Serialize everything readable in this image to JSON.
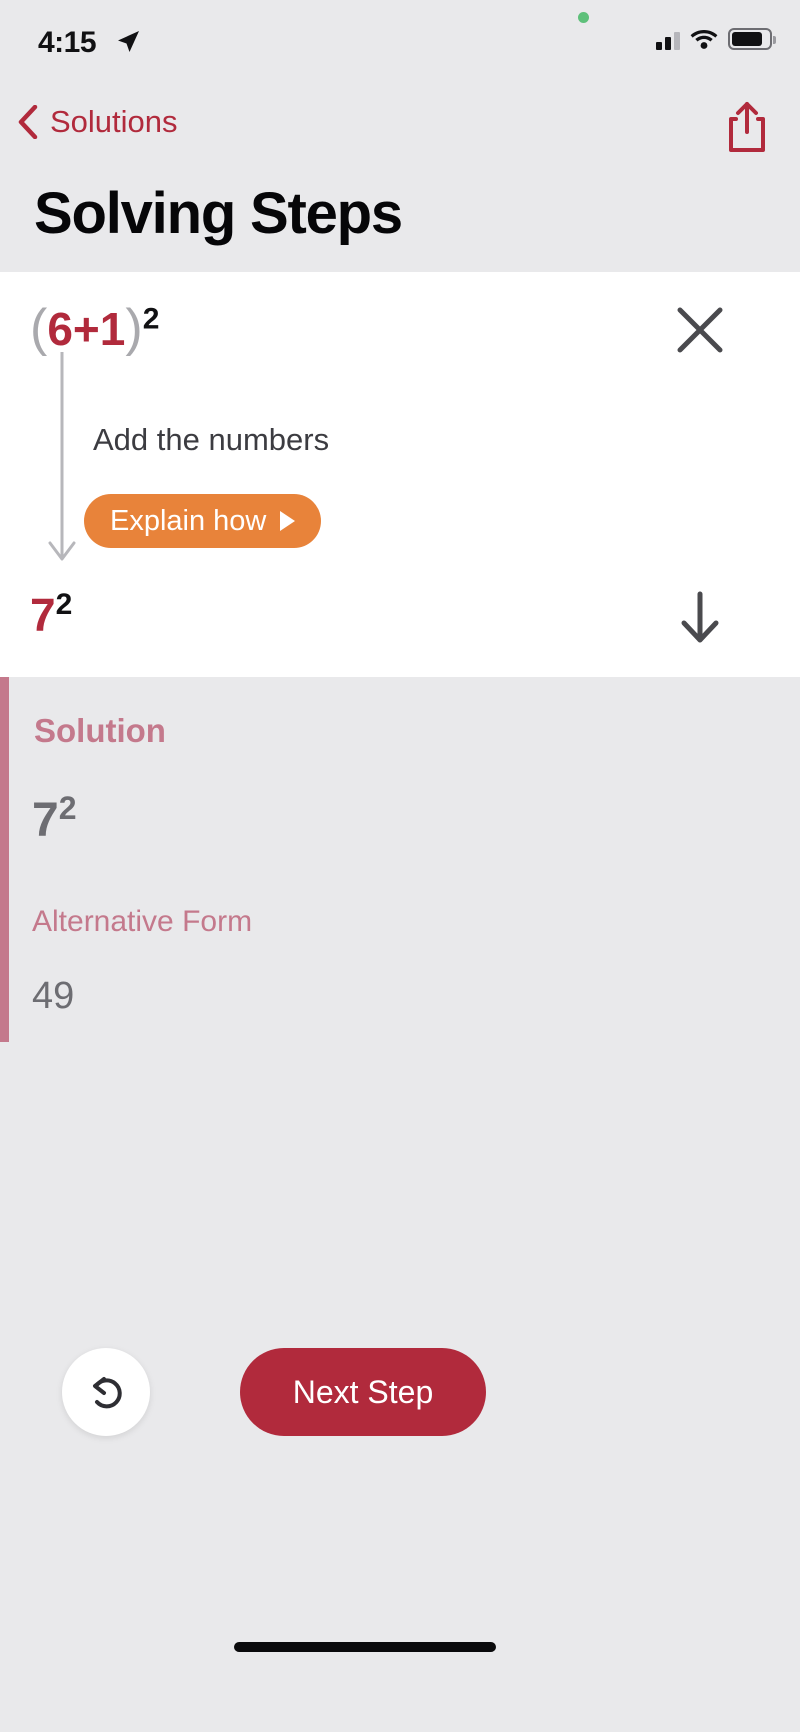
{
  "status_bar": {
    "time": "4:15",
    "location_icon": "location-arrow-icon",
    "signal_icon": "cellular-signal-icon",
    "wifi_icon": "wifi-icon",
    "battery_icon": "battery-icon",
    "recording_indicator": "green-recording-dot"
  },
  "nav": {
    "back_label": "Solutions",
    "back_icon": "chevron-left-icon",
    "share_icon": "share-icon"
  },
  "header": {
    "title": "Solving Steps"
  },
  "step_card": {
    "expression": {
      "open_paren": "(",
      "inner": "6+1",
      "close_paren": ")",
      "exponent": "2"
    },
    "close_icon": "close-x-icon",
    "description": "Add the numbers",
    "explain_button": {
      "label": "Explain how",
      "icon": "play-triangle-icon"
    },
    "result": {
      "base": "7",
      "exponent": "2"
    },
    "next_step_icon": "arrow-down-icon",
    "flow_arrow_icon": "flow-arrow-down-icon"
  },
  "solution": {
    "heading": "Solution",
    "value_base": "7",
    "value_exponent": "2",
    "alternative_label": "Alternative Form",
    "alternative_value": "49"
  },
  "footer": {
    "undo_icon": "undo-arrow-icon",
    "next_step_label": "Next Step"
  },
  "colors": {
    "brand_red": "#b12a3c",
    "accent_orange": "#e8833a",
    "muted_rose": "#c4798c",
    "background": "#e9e9eb",
    "card": "#ffffff",
    "gray_text": "#6d6d72"
  }
}
